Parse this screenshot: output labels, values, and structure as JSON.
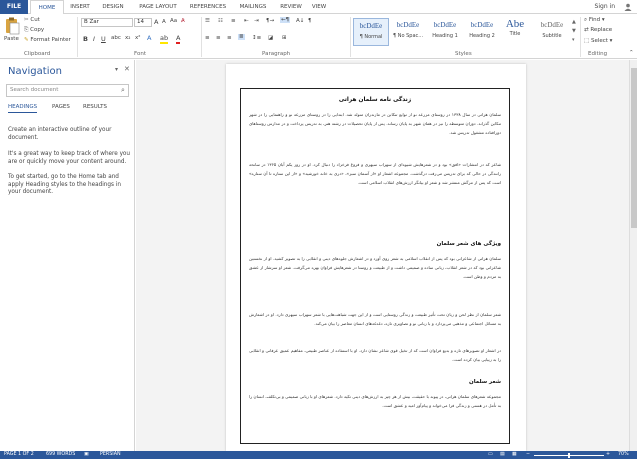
{
  "tabs": [
    "FILE",
    "HOME",
    "INSERT",
    "DESIGN",
    "PAGE LAYOUT",
    "REFERENCES",
    "MAILINGS",
    "REVIEW",
    "VIEW"
  ],
  "signin": "Sign in",
  "clipboard": {
    "paste": "Paste",
    "cut": "Cut",
    "copy": "Copy",
    "format_painter": "Format Painter",
    "label": "Clipboard"
  },
  "font": {
    "name": "B Zar",
    "size": "14",
    "label": "Font"
  },
  "paragraph": {
    "label": "Paragraph"
  },
  "styles": {
    "label": "Styles",
    "items": [
      {
        "preview": "bcDdEe",
        "name": "¶ Normal"
      },
      {
        "preview": "bcDdEe",
        "name": "¶ No Spac..."
      },
      {
        "preview": "bcDdEe",
        "name": "Heading 1"
      },
      {
        "preview": "bcDdEe",
        "name": "Heading 2"
      },
      {
        "preview": "Abe",
        "name": "Title"
      },
      {
        "preview": "bcDdEe",
        "name": "Subtitle"
      }
    ]
  },
  "editing": {
    "find": "Find",
    "replace": "Replace",
    "select": "Select",
    "label": "Editing"
  },
  "nav": {
    "title": "Navigation",
    "search_placeholder": "Search document",
    "tabs": [
      "HEADINGS",
      "PAGES",
      "RESULTS"
    ],
    "text1": "Create an interactive outline of your document.",
    "text2": "It's a great way to keep track of where you are or quickly move your content around.",
    "text3": "To get started, go to the Home tab and apply Heading styles to the headings in your document."
  },
  "doc": {
    "title": "زندگی نامه سلمان هراتی",
    "p1": "سلمان هراتی در سال ۱۳۳۸ در روستای مزرعه نو از توابع تنکابن در مازندران متولد شد. ابتدایی را در روستای مزرعه نو و راهنمایی را در شهر تنکابن گذراند. دوران متوسطه را نیز در همان شهر به پایان رساند. پس از پایان تحصیلات در رشته هنر، به تدریس پرداخت و در مدارس روستاهای دورافتاده مشغول تدریس شد.",
    "p2": "شاعر که در انتشارات «افق» بود و در شعرهایش شیوه‌ای از سهراب سپهری و فروغ فرخزاد را دنبال کرد. او در روز یکم آبان ۱۳۶۵ در سانحه رانندگی در حالی که برای تدریس می‌رفت درگذشت. مجموعه اشعار او «از آسمان سبز»، «دری به خانه خورشید» و «از این ستاره تا آن ستاره» است که پس از مرگش منتشر شد و شعر او بیانگر ارزش‌های انقلاب اسلامی است.",
    "h1": "ویژگی های شعر سلمان",
    "p3": "سلمان هراتی از شاعرانی بود که پس از انقلاب اسلامی به شعر روی آورد و در اشعارش جلوه‌های دینی و انقلابی را به تصویر کشید. او از نخستین شاعرانی بود که در شعر انقلاب، زبانی ساده و صمیمی داشت و از طبیعت و روستا در شعرهایش فراوان بهره می‌گرفت. شعر او سرشار از عشق به مردم و وطن است.",
    "p4": "شعر سلمان از نظر لحن و زبان تحت تأثیر طبیعت و زندگی روستایی است و از این جهت شباهت‌هایی با شعر سهراب سپهری دارد. او در اشعارش به مسائل اجتماعی و مذهبی می‌پردازد و با زبانی نو و تصاویری تازه، دغدغه‌های انسان معاصر را بیان می‌کند.",
    "p5": "در اشعار او تصویرهای تازه و بدیع فراوان است که از تخیل قوی شاعر نشان دارد. او با استفاده از عناصر طبیعی، مفاهیم عمیق عرفانی و انقلابی را به زیبایی بیان کرده است.",
    "h2": "شعر سلمان",
    "p6": "مجموعه شعرهای سلمان هراتی، در پیوند با حقیقت، بیش از هر چیز به ارزش‌های دینی تکیه دارد. شعرهای او با زبانی صمیمی و بی‌تکلف، انسان را به تأمل در هستی و زندگی فرا می‌خواند و پیام‌آور امید و عشق است."
  },
  "status": {
    "page": "PAGE 1 OF 2",
    "words": "699 WORDS",
    "lang": "PERSIAN",
    "zoom": "70%"
  }
}
